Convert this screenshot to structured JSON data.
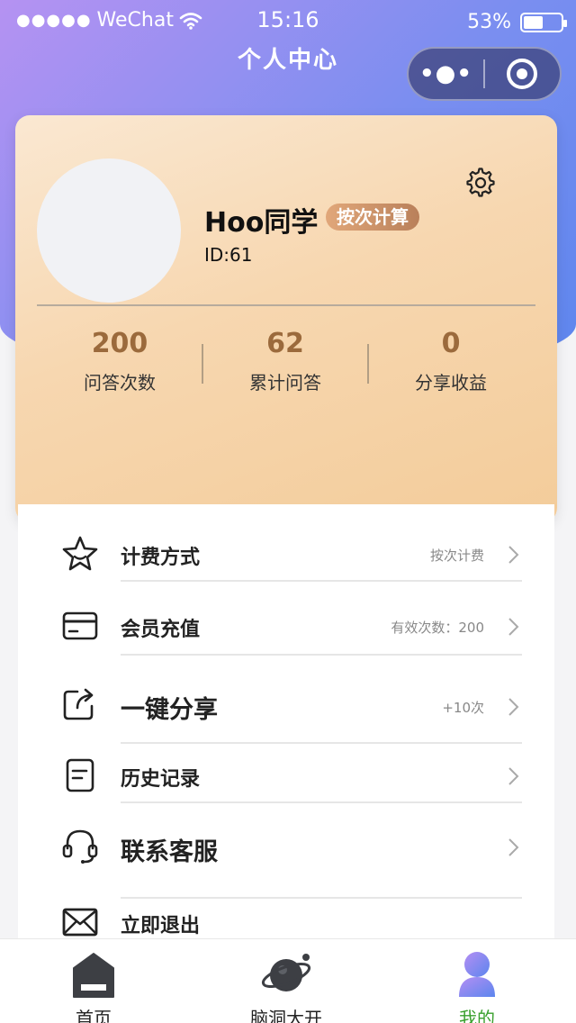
{
  "status_bar": {
    "carrier": "WeChat",
    "time": "15:16",
    "battery": "53%",
    "battery_level": 0.53
  },
  "nav": {
    "title": "个人中心"
  },
  "profile": {
    "username": "Hoo同学",
    "badge": "按次计算",
    "user_id": "ID:61",
    "stats": [
      {
        "value": "200",
        "label": "问答次数"
      },
      {
        "value": "62",
        "label": "累计问答"
      },
      {
        "value": "0",
        "label": "分享收益"
      }
    ]
  },
  "menu": [
    {
      "icon": "star-icon",
      "label": "计费方式",
      "value": "按次计费",
      "large": false
    },
    {
      "icon": "card-icon",
      "label": "会员充值",
      "value": "有效次数：200",
      "large": false
    },
    {
      "icon": "share-icon",
      "label": "一键分享",
      "value": "+10次",
      "large": true
    },
    {
      "icon": "document-icon",
      "label": "历史记录",
      "value": "",
      "large": false
    },
    {
      "icon": "headset-icon",
      "label": "联系客服",
      "value": "",
      "large": true
    },
    {
      "icon": "mail-icon",
      "label": "立即退出",
      "value": "",
      "large": false
    }
  ],
  "tab_bar": [
    {
      "icon": "home-icon",
      "label": "首页",
      "active": false
    },
    {
      "icon": "planet-icon",
      "label": "脑洞大开",
      "active": false
    },
    {
      "icon": "user-icon",
      "label": "我的",
      "active": true
    }
  ],
  "colors": {
    "header_gradient": [
      "#b592f2",
      "#5d86ee"
    ],
    "card_gradient": [
      "#fae8d2",
      "#f3cc9a"
    ],
    "stat_value": "#9b6a3c",
    "active_tab": "#3aa02e"
  }
}
